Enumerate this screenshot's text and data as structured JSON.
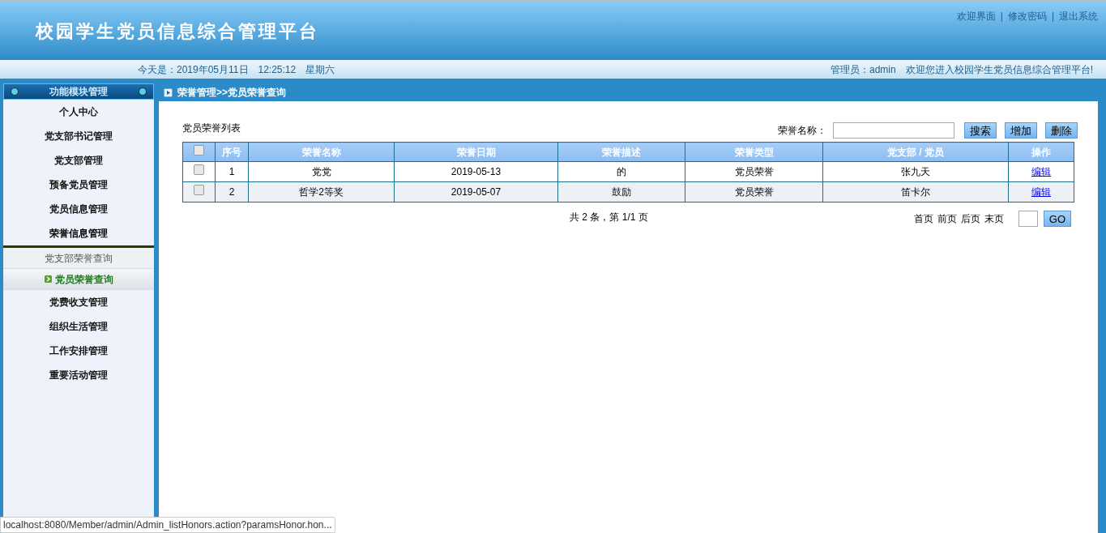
{
  "header": {
    "title": "校园学生党员信息综合管理平台",
    "links": [
      "欢迎界面",
      "修改密码",
      "退出系统"
    ],
    "separator": "|"
  },
  "info_bar": {
    "date": "今天是：2019年05月11日",
    "time": "12:25:12",
    "weekday": "星期六",
    "user": "管理员：admin",
    "welcome": "欢迎您进入校园学生党员信息综合管理平台!"
  },
  "sidebar": {
    "title": "功能模块管理",
    "items": [
      {
        "label": "个人中心",
        "expanded": false
      },
      {
        "label": "党支部书记管理",
        "expanded": false
      },
      {
        "label": "党支部管理",
        "expanded": false
      },
      {
        "label": "预备党员管理",
        "expanded": false
      },
      {
        "label": "党员信息管理",
        "expanded": false
      },
      {
        "label": "荣誉信息管理",
        "expanded": true,
        "children": [
          {
            "label": "党支部荣誉查询",
            "selected": false
          },
          {
            "label": "党员荣誉查询",
            "selected": true
          }
        ]
      },
      {
        "label": "党费收支管理",
        "expanded": false
      },
      {
        "label": "组织生活管理",
        "expanded": false
      },
      {
        "label": "工作安排管理",
        "expanded": false
      },
      {
        "label": "重要活动管理",
        "expanded": false
      }
    ]
  },
  "breadcrumb": "荣誉管理>>党员荣誉查询",
  "list_title": "党员荣誉列表",
  "search": {
    "label": "荣誉名称：",
    "buttons": [
      "搜索",
      "增加",
      "删除"
    ]
  },
  "table": {
    "header_checked": false,
    "columns": [
      "序号",
      "荣誉名称",
      "荣誉日期",
      "荣誉描述",
      "荣誉类型",
      "党支部 / 党员",
      "操作"
    ],
    "rows": [
      {
        "checked": false,
        "cells": [
          "1",
          "党党",
          "2019-05-13",
          "的",
          "党员荣誉",
          "张九天"
        ],
        "action": "编辑"
      },
      {
        "checked": false,
        "cells": [
          "2",
          "哲学2等奖",
          "2019-05-07",
          "鼓励",
          "党员荣誉",
          "笛卡尔"
        ],
        "action": "编辑"
      }
    ]
  },
  "pagination": {
    "summary": "共 2 条，第 1/1 页",
    "links": [
      "首页",
      "前页",
      "后页",
      "末页"
    ],
    "go": "GO"
  },
  "status_url": "localhost:8080/Member/admin/Admin_listHonors.action?paramsHonor.hon..."
}
